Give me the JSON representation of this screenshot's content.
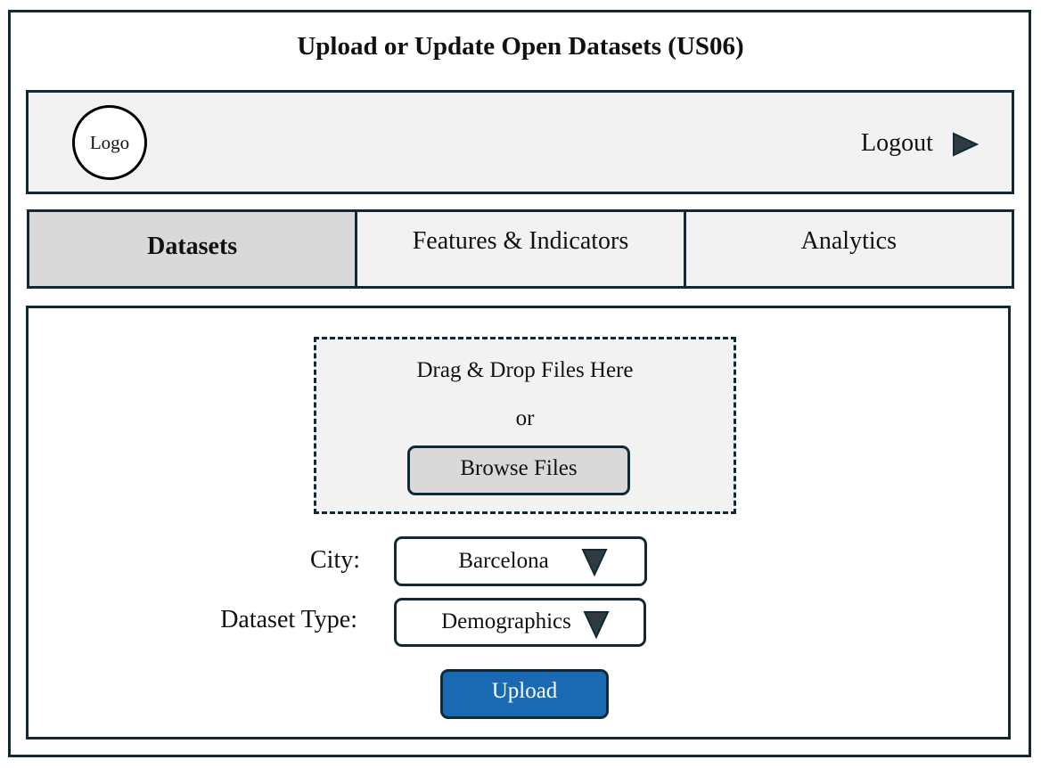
{
  "page": {
    "title": "Upload or Update Open Datasets (US06)"
  },
  "header": {
    "logo_text": "Logo",
    "logout_label": "Logout",
    "logout_icon": "play-arrow-icon"
  },
  "tabs": [
    {
      "label": "Datasets",
      "active": true
    },
    {
      "label": "Features & Indicators",
      "active": false
    },
    {
      "label": "Analytics",
      "active": false
    }
  ],
  "upload_form": {
    "dropzone_text": "Drag & Drop Files Here",
    "or_text": "or",
    "browse_label": "Browse Files",
    "city_label": "City:",
    "city_value": "Barcelona",
    "dataset_type_label": "Dataset Type:",
    "dataset_type_value": "Demographics",
    "dropdown_icon": "triangle-down-icon",
    "upload_label": "Upload"
  },
  "colors": {
    "border": "#0f2a35",
    "panel_bg": "#f2f2f2",
    "active_tab_bg": "#d9d9d9",
    "upload_button": "#1a6ab3"
  }
}
